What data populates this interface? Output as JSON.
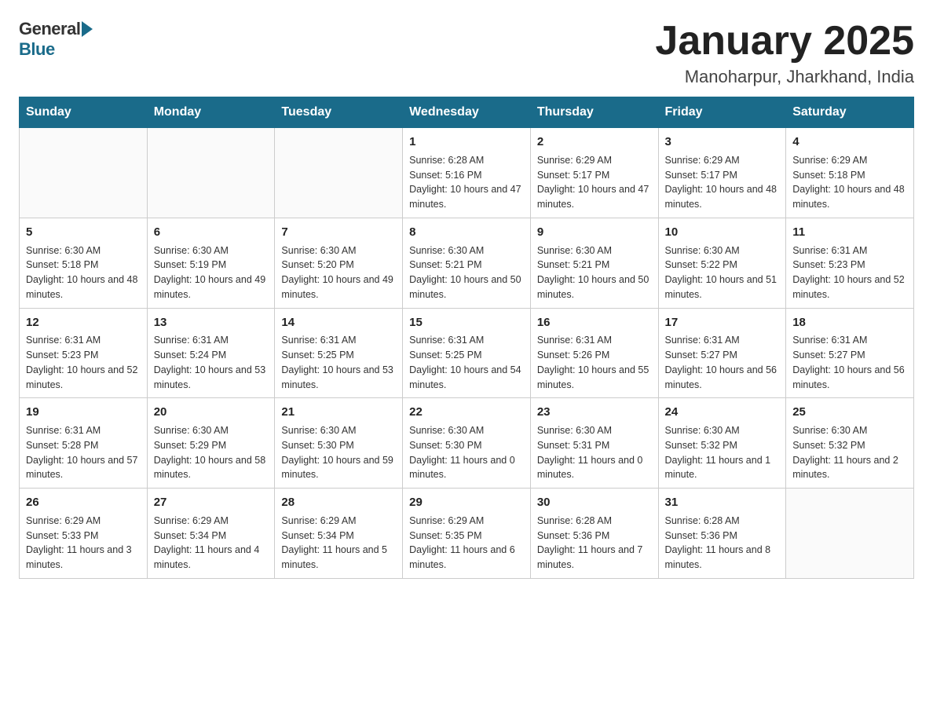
{
  "logo": {
    "general": "General",
    "blue": "Blue"
  },
  "title": "January 2025",
  "subtitle": "Manoharpur, Jharkhand, India",
  "days_header": [
    "Sunday",
    "Monday",
    "Tuesday",
    "Wednesday",
    "Thursday",
    "Friday",
    "Saturday"
  ],
  "weeks": [
    [
      {
        "day": "",
        "info": ""
      },
      {
        "day": "",
        "info": ""
      },
      {
        "day": "",
        "info": ""
      },
      {
        "day": "1",
        "info": "Sunrise: 6:28 AM\nSunset: 5:16 PM\nDaylight: 10 hours and 47 minutes."
      },
      {
        "day": "2",
        "info": "Sunrise: 6:29 AM\nSunset: 5:17 PM\nDaylight: 10 hours and 47 minutes."
      },
      {
        "day": "3",
        "info": "Sunrise: 6:29 AM\nSunset: 5:17 PM\nDaylight: 10 hours and 48 minutes."
      },
      {
        "day": "4",
        "info": "Sunrise: 6:29 AM\nSunset: 5:18 PM\nDaylight: 10 hours and 48 minutes."
      }
    ],
    [
      {
        "day": "5",
        "info": "Sunrise: 6:30 AM\nSunset: 5:18 PM\nDaylight: 10 hours and 48 minutes."
      },
      {
        "day": "6",
        "info": "Sunrise: 6:30 AM\nSunset: 5:19 PM\nDaylight: 10 hours and 49 minutes."
      },
      {
        "day": "7",
        "info": "Sunrise: 6:30 AM\nSunset: 5:20 PM\nDaylight: 10 hours and 49 minutes."
      },
      {
        "day": "8",
        "info": "Sunrise: 6:30 AM\nSunset: 5:21 PM\nDaylight: 10 hours and 50 minutes."
      },
      {
        "day": "9",
        "info": "Sunrise: 6:30 AM\nSunset: 5:21 PM\nDaylight: 10 hours and 50 minutes."
      },
      {
        "day": "10",
        "info": "Sunrise: 6:30 AM\nSunset: 5:22 PM\nDaylight: 10 hours and 51 minutes."
      },
      {
        "day": "11",
        "info": "Sunrise: 6:31 AM\nSunset: 5:23 PM\nDaylight: 10 hours and 52 minutes."
      }
    ],
    [
      {
        "day": "12",
        "info": "Sunrise: 6:31 AM\nSunset: 5:23 PM\nDaylight: 10 hours and 52 minutes."
      },
      {
        "day": "13",
        "info": "Sunrise: 6:31 AM\nSunset: 5:24 PM\nDaylight: 10 hours and 53 minutes."
      },
      {
        "day": "14",
        "info": "Sunrise: 6:31 AM\nSunset: 5:25 PM\nDaylight: 10 hours and 53 minutes."
      },
      {
        "day": "15",
        "info": "Sunrise: 6:31 AM\nSunset: 5:25 PM\nDaylight: 10 hours and 54 minutes."
      },
      {
        "day": "16",
        "info": "Sunrise: 6:31 AM\nSunset: 5:26 PM\nDaylight: 10 hours and 55 minutes."
      },
      {
        "day": "17",
        "info": "Sunrise: 6:31 AM\nSunset: 5:27 PM\nDaylight: 10 hours and 56 minutes."
      },
      {
        "day": "18",
        "info": "Sunrise: 6:31 AM\nSunset: 5:27 PM\nDaylight: 10 hours and 56 minutes."
      }
    ],
    [
      {
        "day": "19",
        "info": "Sunrise: 6:31 AM\nSunset: 5:28 PM\nDaylight: 10 hours and 57 minutes."
      },
      {
        "day": "20",
        "info": "Sunrise: 6:30 AM\nSunset: 5:29 PM\nDaylight: 10 hours and 58 minutes."
      },
      {
        "day": "21",
        "info": "Sunrise: 6:30 AM\nSunset: 5:30 PM\nDaylight: 10 hours and 59 minutes."
      },
      {
        "day": "22",
        "info": "Sunrise: 6:30 AM\nSunset: 5:30 PM\nDaylight: 11 hours and 0 minutes."
      },
      {
        "day": "23",
        "info": "Sunrise: 6:30 AM\nSunset: 5:31 PM\nDaylight: 11 hours and 0 minutes."
      },
      {
        "day": "24",
        "info": "Sunrise: 6:30 AM\nSunset: 5:32 PM\nDaylight: 11 hours and 1 minute."
      },
      {
        "day": "25",
        "info": "Sunrise: 6:30 AM\nSunset: 5:32 PM\nDaylight: 11 hours and 2 minutes."
      }
    ],
    [
      {
        "day": "26",
        "info": "Sunrise: 6:29 AM\nSunset: 5:33 PM\nDaylight: 11 hours and 3 minutes."
      },
      {
        "day": "27",
        "info": "Sunrise: 6:29 AM\nSunset: 5:34 PM\nDaylight: 11 hours and 4 minutes."
      },
      {
        "day": "28",
        "info": "Sunrise: 6:29 AM\nSunset: 5:34 PM\nDaylight: 11 hours and 5 minutes."
      },
      {
        "day": "29",
        "info": "Sunrise: 6:29 AM\nSunset: 5:35 PM\nDaylight: 11 hours and 6 minutes."
      },
      {
        "day": "30",
        "info": "Sunrise: 6:28 AM\nSunset: 5:36 PM\nDaylight: 11 hours and 7 minutes."
      },
      {
        "day": "31",
        "info": "Sunrise: 6:28 AM\nSunset: 5:36 PM\nDaylight: 11 hours and 8 minutes."
      },
      {
        "day": "",
        "info": ""
      }
    ]
  ]
}
